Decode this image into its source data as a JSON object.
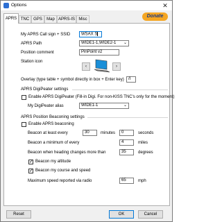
{
  "window": {
    "title": "Options",
    "close_glyph": "✕"
  },
  "tabs": [
    {
      "label": "APRS",
      "active": true
    },
    {
      "label": "TNC",
      "active": false
    },
    {
      "label": "GPS",
      "active": false
    },
    {
      "label": "Map",
      "active": false
    },
    {
      "label": "APRS-IS",
      "active": false
    },
    {
      "label": "Misc",
      "active": false
    }
  ],
  "donate": {
    "label": "Donate"
  },
  "aprs": {
    "callsign_label": "My APRS Call sign + SSID",
    "callsign_value": "WSAX S",
    "path_label": "APRS Path",
    "path_value": "WIDE1-1,WIDE2-1",
    "comment_label": "Position comment",
    "comment_value": "PinPoint v2",
    "station_icon_label": "Station icon",
    "overlay_label": "Overlay (type table + symbol directly in box + Enter key)",
    "overlay_value": "/l"
  },
  "digipeater": {
    "section_label": "APRS DigiPeater settings",
    "enable_label": "Enable APRS DigiPeater (Fill-in Digi. For non-KISS TNC's only for the moment)",
    "enable_checked": false,
    "alias_label": "My DigiPeater alias",
    "alias_value": "WIDE1-1"
  },
  "beaconing": {
    "section_label": "APRS Position Beaconing settings",
    "enable_label": "Enable APRS beaconing",
    "enable_checked": false,
    "at_least_label": "Beacon at least every",
    "at_least_minutes": "30",
    "minutes_unit": "minutes",
    "at_least_seconds": "0",
    "seconds_unit": "seconds",
    "min_label": "Beacon a minimum of every",
    "min_value": "4",
    "miles_unit": "miles",
    "heading_label": "Beacon when heading changes more than",
    "heading_value": "35",
    "degrees_unit": "degrees",
    "altitude_label": "Beacon my altitude",
    "altitude_checked": true,
    "course_label": "Beacon my course and speed",
    "course_checked": true,
    "max_speed_label": "Maximum speed reported via radio",
    "max_speed_value": "65",
    "mph_unit": "mph"
  },
  "footer": {
    "reset_label": "Reset",
    "ok_label": "OK",
    "cancel_label": "Cancel"
  },
  "icons": {
    "prev": "‹",
    "next": "›",
    "dropdown": "⌄",
    "station": "laptop-icon"
  },
  "colors": {
    "donate_bg": "#f5a623",
    "focus_border": "#0078d7",
    "station_screen": "#1a8fd8"
  }
}
